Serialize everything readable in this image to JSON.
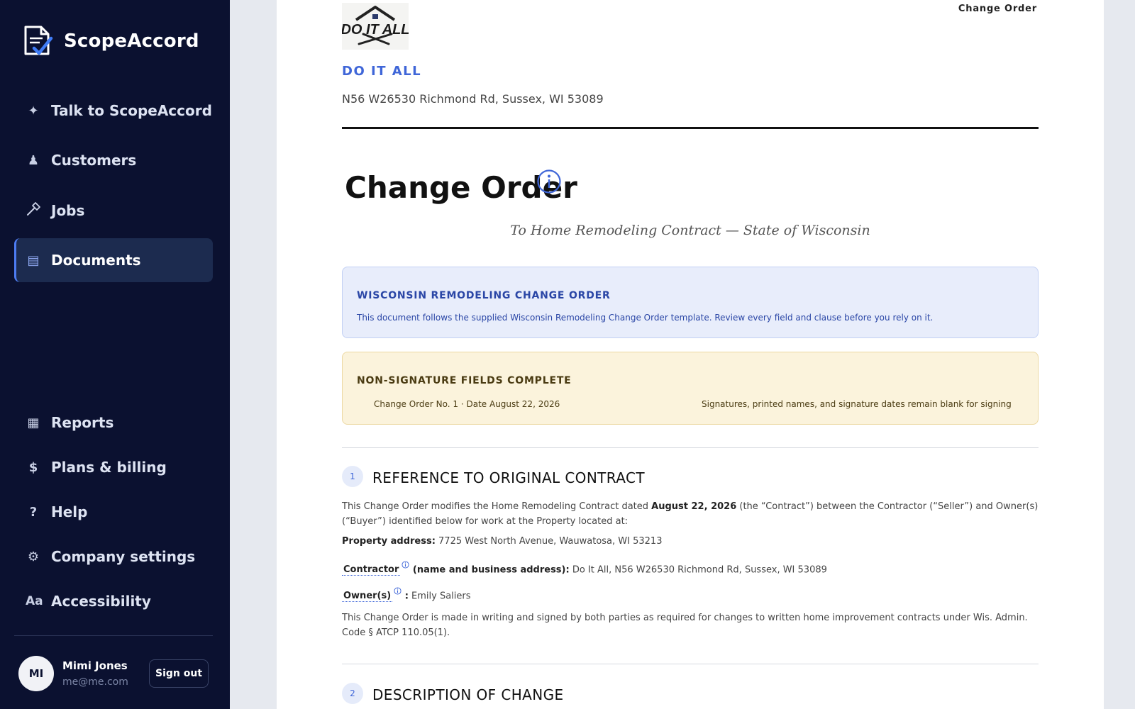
{
  "app": {
    "name": "ScopeAccord"
  },
  "sidebar": {
    "nav": [
      {
        "label": "Talk to ScopeAccord",
        "icon": "sparkle-icon"
      },
      {
        "label": "Customers",
        "icon": "person-icon"
      },
      {
        "label": "Jobs",
        "icon": "hammer-icon"
      },
      {
        "label": "Documents",
        "icon": "document-list-icon",
        "active": true
      }
    ],
    "nav_bottom": [
      {
        "label": "Reports",
        "icon": "grid-icon"
      },
      {
        "label": "Plans & billing",
        "icon": "dollar-icon"
      },
      {
        "label": "Help",
        "icon": "question-icon"
      },
      {
        "label": "Company settings",
        "icon": "gear-icon"
      },
      {
        "label": "Accessibility",
        "icon": "text-size-icon"
      }
    ],
    "user": {
      "initials": "MI",
      "name": "Mimi Jones",
      "email": "me@me.com"
    },
    "sign_out_label": "Sign out"
  },
  "document": {
    "tag": "Change Order",
    "company_name": "DO IT ALL",
    "logo_text": "DO IT ALL",
    "company_address": "N56 W26530 Richmond Rd, Sussex, WI 53089",
    "title": "Change Order",
    "subtitle": "To Home Remodeling Contract — State of Wisconsin",
    "notice_blue": {
      "title": "WISCONSIN REMODELING CHANGE ORDER",
      "text": "This document follows the supplied Wisconsin Remodeling Change Order template. Review every field and clause before you rely on it."
    },
    "notice_yellow": {
      "title": "NON-SIGNATURE FIELDS COMPLETE",
      "left": "Change Order No. 1 · Date August 22, 2026",
      "right": "Signatures, printed names, and signature dates remain blank for signing"
    },
    "section1": {
      "num": "1",
      "title": "REFERENCE TO ORIGINAL CONTRACT",
      "para_pre": "This Change Order modifies the Home Remodeling Contract dated ",
      "para_date": "August 22, 2026",
      "para_post": " (the “Contract”) between the Contractor (“Seller”) and Owner(s) (“Buyer”) identified below for work at the Property located at:",
      "property_label": "Property address:",
      "property_value": " 7725 West North Avenue, Wauwatosa, WI 53213",
      "contractor_label": "Contractor",
      "contractor_suffix": " (name and business address):",
      "contractor_value": " Do It All, N56 W26530 Richmond Rd, Sussex, WI 53089",
      "owner_label": "Owner(s)",
      "owner_suffix": " :",
      "owner_value": " Emily Saliers",
      "closing": "This Change Order is made in writing and signed by both parties as required for changes to written home improvement contracts under Wis. Admin. Code § ATCP 110.05(1)."
    },
    "section2": {
      "num": "2",
      "title": "DESCRIPTION OF CHANGE"
    }
  },
  "colors": {
    "sidebar_bg": "#0b1130",
    "accent": "#3f66d8",
    "active_nav": "#1c2b4f"
  }
}
